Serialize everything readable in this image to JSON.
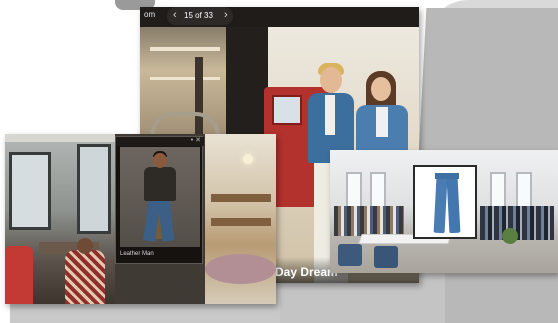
{
  "viewer": {
    "brand_tag": "om",
    "pager": {
      "prev_icon": "‹",
      "count": "15 of 33",
      "next_icon": "›"
    },
    "caption": "Day Dream"
  },
  "left_card": {
    "popup_label": "Leather Man",
    "popup_controls": "• ✕"
  },
  "right_card": {
    "product_icon": "jeans"
  },
  "colors": {
    "accent_red": "#b3322d",
    "denim": "#4a7cb4",
    "dark_ui": "#1f1c1a"
  }
}
